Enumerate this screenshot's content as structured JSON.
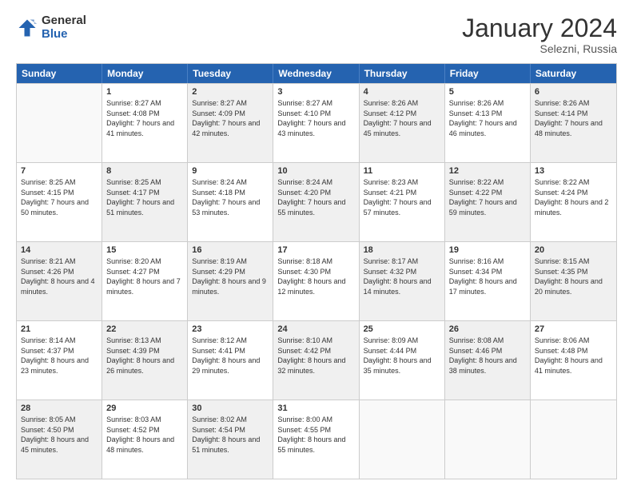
{
  "header": {
    "logo_general": "General",
    "logo_blue": "Blue",
    "month_title": "January 2024",
    "location": "Selezni, Russia"
  },
  "days_of_week": [
    "Sunday",
    "Monday",
    "Tuesday",
    "Wednesday",
    "Thursday",
    "Friday",
    "Saturday"
  ],
  "weeks": [
    [
      {
        "day": "",
        "empty": true,
        "shaded": false
      },
      {
        "day": "1",
        "empty": false,
        "shaded": false,
        "sunrise": "8:27 AM",
        "sunset": "4:08 PM",
        "daylight": "7 hours and 41 minutes."
      },
      {
        "day": "2",
        "empty": false,
        "shaded": true,
        "sunrise": "8:27 AM",
        "sunset": "4:09 PM",
        "daylight": "7 hours and 42 minutes."
      },
      {
        "day": "3",
        "empty": false,
        "shaded": false,
        "sunrise": "8:27 AM",
        "sunset": "4:10 PM",
        "daylight": "7 hours and 43 minutes."
      },
      {
        "day": "4",
        "empty": false,
        "shaded": true,
        "sunrise": "8:26 AM",
        "sunset": "4:12 PM",
        "daylight": "7 hours and 45 minutes."
      },
      {
        "day": "5",
        "empty": false,
        "shaded": false,
        "sunrise": "8:26 AM",
        "sunset": "4:13 PM",
        "daylight": "7 hours and 46 minutes."
      },
      {
        "day": "6",
        "empty": false,
        "shaded": true,
        "sunrise": "8:26 AM",
        "sunset": "4:14 PM",
        "daylight": "7 hours and 48 minutes."
      }
    ],
    [
      {
        "day": "7",
        "empty": false,
        "shaded": false,
        "sunrise": "8:25 AM",
        "sunset": "4:15 PM",
        "daylight": "7 hours and 50 minutes."
      },
      {
        "day": "8",
        "empty": false,
        "shaded": true,
        "sunrise": "8:25 AM",
        "sunset": "4:17 PM",
        "daylight": "7 hours and 51 minutes."
      },
      {
        "day": "9",
        "empty": false,
        "shaded": false,
        "sunrise": "8:24 AM",
        "sunset": "4:18 PM",
        "daylight": "7 hours and 53 minutes."
      },
      {
        "day": "10",
        "empty": false,
        "shaded": true,
        "sunrise": "8:24 AM",
        "sunset": "4:20 PM",
        "daylight": "7 hours and 55 minutes."
      },
      {
        "day": "11",
        "empty": false,
        "shaded": false,
        "sunrise": "8:23 AM",
        "sunset": "4:21 PM",
        "daylight": "7 hours and 57 minutes."
      },
      {
        "day": "12",
        "empty": false,
        "shaded": true,
        "sunrise": "8:22 AM",
        "sunset": "4:22 PM",
        "daylight": "7 hours and 59 minutes."
      },
      {
        "day": "13",
        "empty": false,
        "shaded": false,
        "sunrise": "8:22 AM",
        "sunset": "4:24 PM",
        "daylight": "8 hours and 2 minutes."
      }
    ],
    [
      {
        "day": "14",
        "empty": false,
        "shaded": true,
        "sunrise": "8:21 AM",
        "sunset": "4:26 PM",
        "daylight": "8 hours and 4 minutes."
      },
      {
        "day": "15",
        "empty": false,
        "shaded": false,
        "sunrise": "8:20 AM",
        "sunset": "4:27 PM",
        "daylight": "8 hours and 7 minutes."
      },
      {
        "day": "16",
        "empty": false,
        "shaded": true,
        "sunrise": "8:19 AM",
        "sunset": "4:29 PM",
        "daylight": "8 hours and 9 minutes."
      },
      {
        "day": "17",
        "empty": false,
        "shaded": false,
        "sunrise": "8:18 AM",
        "sunset": "4:30 PM",
        "daylight": "8 hours and 12 minutes."
      },
      {
        "day": "18",
        "empty": false,
        "shaded": true,
        "sunrise": "8:17 AM",
        "sunset": "4:32 PM",
        "daylight": "8 hours and 14 minutes."
      },
      {
        "day": "19",
        "empty": false,
        "shaded": false,
        "sunrise": "8:16 AM",
        "sunset": "4:34 PM",
        "daylight": "8 hours and 17 minutes."
      },
      {
        "day": "20",
        "empty": false,
        "shaded": true,
        "sunrise": "8:15 AM",
        "sunset": "4:35 PM",
        "daylight": "8 hours and 20 minutes."
      }
    ],
    [
      {
        "day": "21",
        "empty": false,
        "shaded": false,
        "sunrise": "8:14 AM",
        "sunset": "4:37 PM",
        "daylight": "8 hours and 23 minutes."
      },
      {
        "day": "22",
        "empty": false,
        "shaded": true,
        "sunrise": "8:13 AM",
        "sunset": "4:39 PM",
        "daylight": "8 hours and 26 minutes."
      },
      {
        "day": "23",
        "empty": false,
        "shaded": false,
        "sunrise": "8:12 AM",
        "sunset": "4:41 PM",
        "daylight": "8 hours and 29 minutes."
      },
      {
        "day": "24",
        "empty": false,
        "shaded": true,
        "sunrise": "8:10 AM",
        "sunset": "4:42 PM",
        "daylight": "8 hours and 32 minutes."
      },
      {
        "day": "25",
        "empty": false,
        "shaded": false,
        "sunrise": "8:09 AM",
        "sunset": "4:44 PM",
        "daylight": "8 hours and 35 minutes."
      },
      {
        "day": "26",
        "empty": false,
        "shaded": true,
        "sunrise": "8:08 AM",
        "sunset": "4:46 PM",
        "daylight": "8 hours and 38 minutes."
      },
      {
        "day": "27",
        "empty": false,
        "shaded": false,
        "sunrise": "8:06 AM",
        "sunset": "4:48 PM",
        "daylight": "8 hours and 41 minutes."
      }
    ],
    [
      {
        "day": "28",
        "empty": false,
        "shaded": true,
        "sunrise": "8:05 AM",
        "sunset": "4:50 PM",
        "daylight": "8 hours and 45 minutes."
      },
      {
        "day": "29",
        "empty": false,
        "shaded": false,
        "sunrise": "8:03 AM",
        "sunset": "4:52 PM",
        "daylight": "8 hours and 48 minutes."
      },
      {
        "day": "30",
        "empty": false,
        "shaded": true,
        "sunrise": "8:02 AM",
        "sunset": "4:54 PM",
        "daylight": "8 hours and 51 minutes."
      },
      {
        "day": "31",
        "empty": false,
        "shaded": false,
        "sunrise": "8:00 AM",
        "sunset": "4:55 PM",
        "daylight": "8 hours and 55 minutes."
      },
      {
        "day": "",
        "empty": true,
        "shaded": false
      },
      {
        "day": "",
        "empty": true,
        "shaded": false
      },
      {
        "day": "",
        "empty": true,
        "shaded": false
      }
    ]
  ],
  "labels": {
    "sunrise": "Sunrise:",
    "sunset": "Sunset:",
    "daylight": "Daylight:"
  }
}
